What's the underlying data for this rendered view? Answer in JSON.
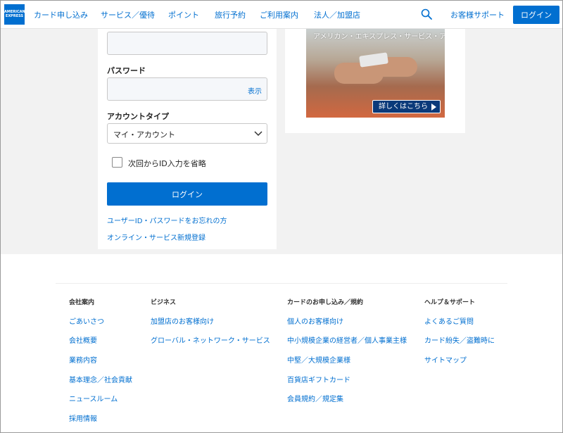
{
  "header": {
    "logo_text": "AMERICAN EXPRESS",
    "nav": [
      {
        "label": "カード申し込み"
      },
      {
        "label": "サービス／優待"
      },
      {
        "label": "ポイント"
      },
      {
        "label": "旅行予約"
      },
      {
        "label": "ご利用案内"
      },
      {
        "label": "法人／加盟店"
      }
    ],
    "support_label": "お客様サポート",
    "login_label": "ログイン",
    "brand_color": "#016fd0"
  },
  "login_form": {
    "userid_value": "",
    "password_label": "パスワード",
    "password_value": "",
    "show_label": "表示",
    "account_type_label": "アカウントタイプ",
    "account_type_value": "マイ・アカウント",
    "remember_label": "次回からID入力を省略",
    "submit_label": "ログイン",
    "forgot_link": "ユーザーID・パスワードをお忘れの方",
    "register_link": "オンライン・サービス新規登録"
  },
  "promo": {
    "title": "アメリカン・エキスプレス・サービス・アプリ",
    "cta_label": "詳しくはこちら"
  },
  "footer": {
    "columns": [
      {
        "heading": "会社案内",
        "links": [
          "ごあいさつ",
          "会社概要",
          "業務内容",
          "基本理念／社会貢献",
          "ニュースルーム",
          "採用情報"
        ]
      },
      {
        "heading": "ビジネス",
        "links": [
          "加盟店のお客様向け",
          "グローバル・ネットワーク・サービス"
        ]
      },
      {
        "heading": "カードのお申し込み／規約",
        "links": [
          "個人のお客様向け",
          "中小規模企業の経営者／個人事業主様",
          "中堅／大規模企業様",
          "百貨店ギフトカード",
          "会員規約／規定集"
        ]
      },
      {
        "heading": "ヘルプ＆サポート",
        "links": [
          "よくあるご質問",
          "カード紛失／盗難時に",
          "サイトマップ"
        ]
      }
    ]
  }
}
